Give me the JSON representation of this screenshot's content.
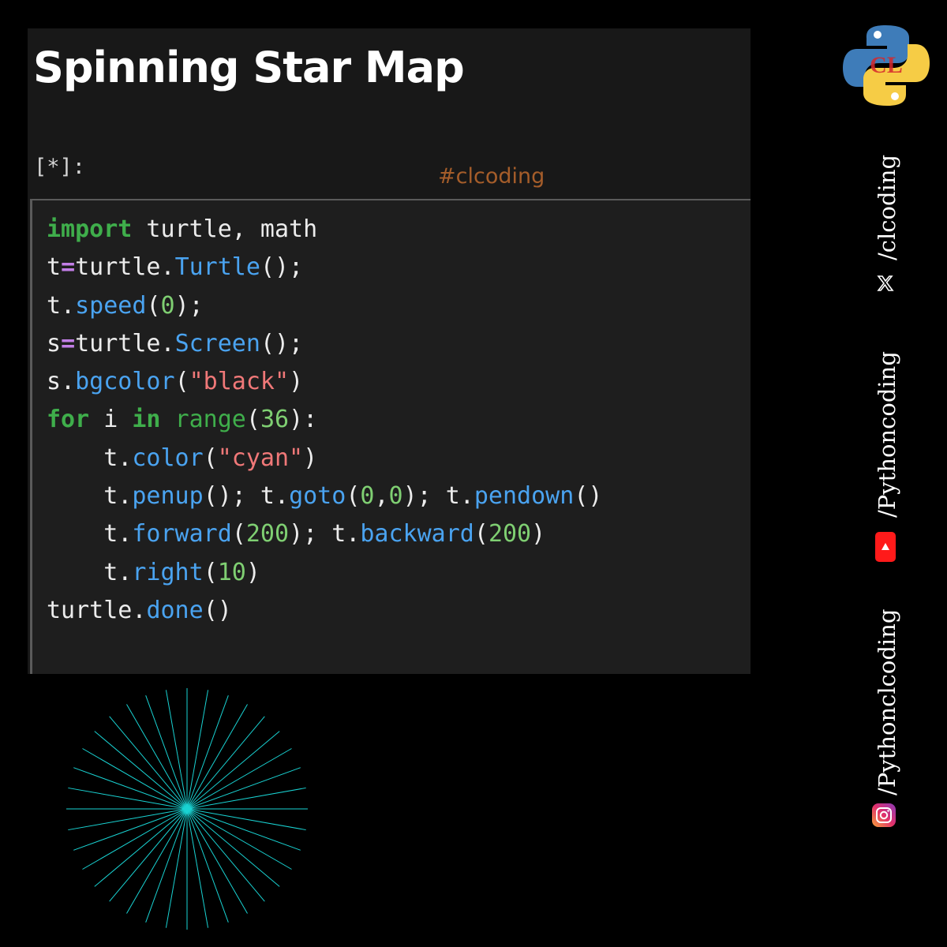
{
  "title": "Spinning Star Map",
  "cell": {
    "prompt": "[*]:",
    "watermark": "#clcoding"
  },
  "code_lines": [
    "import turtle, math",
    "t=turtle.Turtle();",
    "t.speed(0);",
    "s=turtle.Screen();",
    "s.bgcolor(\"black\")",
    "for i in range(36):",
    "    t.color(\"cyan\")",
    "    t.penup(); t.goto(0,0); t.pendown()",
    "    t.forward(200); t.backward(200)",
    "    t.right(10)",
    "turtle.done()"
  ],
  "output": {
    "line_count": 36,
    "turn_degrees": 10,
    "line_color": "#19d3d3",
    "background": "#000000"
  },
  "social": {
    "twitter_handle": "/clcoding",
    "youtube_handle": "/Pythoncoding",
    "instagram_handle": "/Pythonclcoding"
  },
  "logo": {
    "overlay_text": "CL"
  },
  "colors": {
    "keyword": "#3fae4b",
    "function": "#4aa3f0",
    "number": "#7fcf72",
    "string": "#f07878",
    "operator": "#c27ee6",
    "watermark": "#b5652c"
  }
}
